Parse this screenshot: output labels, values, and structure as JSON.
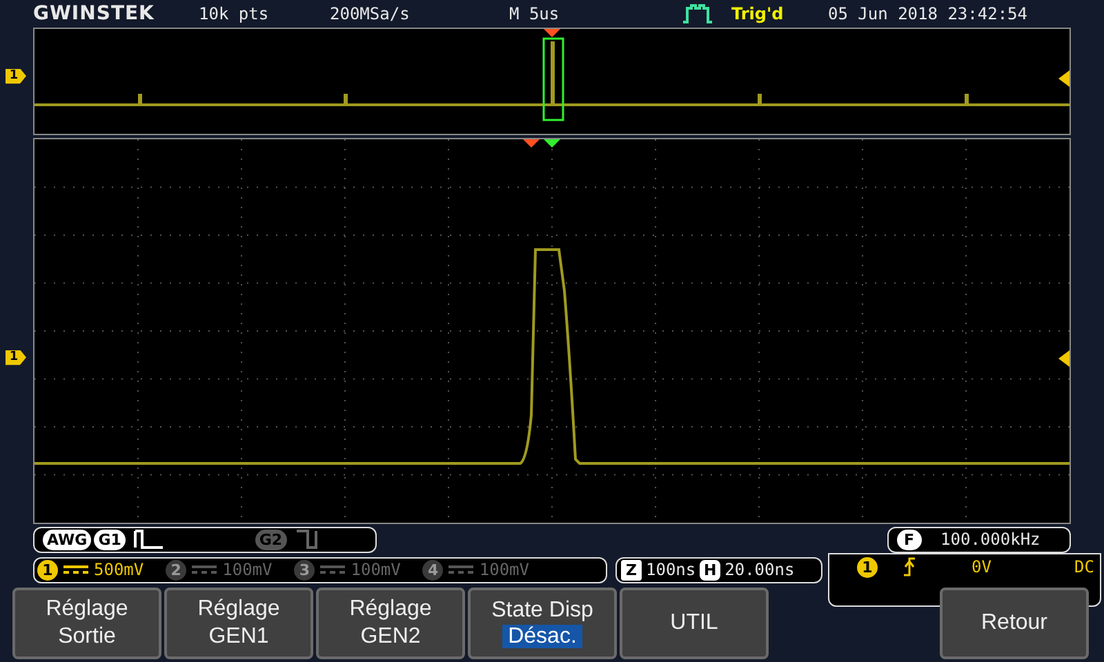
{
  "header": {
    "logo": "GWINSTEK",
    "record_length": "10k pts",
    "sample_rate": "200MSa/s",
    "timebase": "M 5us",
    "trigger_status": "Trig'd",
    "datetime": "05 Jun 2018 23:42:54"
  },
  "overview": {
    "channel_marker": "1"
  },
  "display": {
    "channel_marker": "1"
  },
  "awg": {
    "label": "AWG",
    "generators": [
      {
        "label": "G1",
        "on": true
      },
      {
        "label": "G2",
        "on": false
      }
    ]
  },
  "frequency": {
    "badge": "F",
    "value": "100.000kHz"
  },
  "channels": [
    {
      "badge": "1",
      "scale": "500mV",
      "on": true
    },
    {
      "badge": "2",
      "scale": "100mV",
      "on": false
    },
    {
      "badge": "3",
      "scale": "100mV",
      "on": false
    },
    {
      "badge": "4",
      "scale": "100mV",
      "on": false
    }
  ],
  "zoom": {
    "z_badge": "Z",
    "z_value": "100ns",
    "h_badge": "H",
    "h_value": "20.00ns"
  },
  "trigger": {
    "source": "1",
    "level": "0V",
    "coupling": "DC"
  },
  "softkeys": [
    {
      "lines": [
        "Réglage",
        "Sortie"
      ]
    },
    {
      "lines": [
        "Réglage",
        "GEN1"
      ]
    },
    {
      "lines": [
        "Réglage",
        "GEN2"
      ]
    },
    {
      "lines": [
        "State Disp"
      ],
      "value": "Désac."
    },
    {
      "lines": [
        "UTIL"
      ]
    },
    {
      "lines": [
        "Retour"
      ]
    }
  ]
}
